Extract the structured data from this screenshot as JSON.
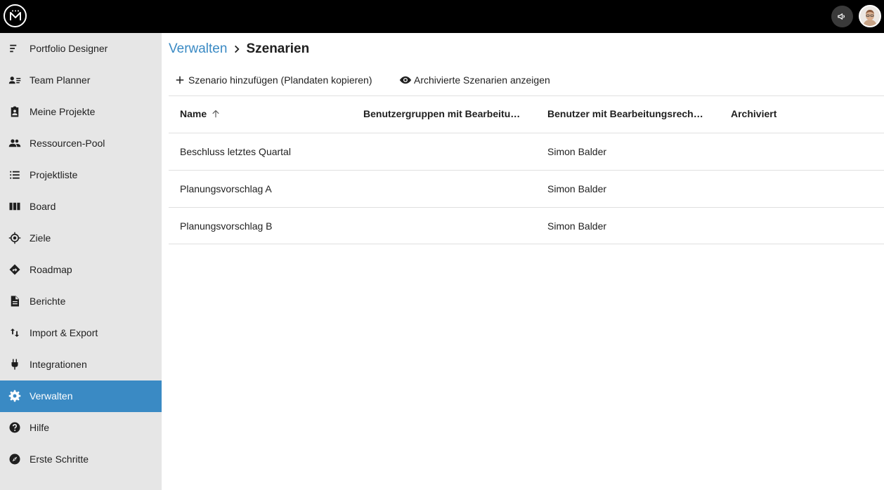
{
  "header": {
    "logo_icon": "brand-logo-icon",
    "announce_icon": "megaphone-icon",
    "avatar_icon": "user-avatar"
  },
  "sidebar": {
    "items": [
      {
        "label": "Portfolio Designer",
        "icon": "portfolio-designer-icon"
      },
      {
        "label": "Team Planner",
        "icon": "team-planner-icon"
      },
      {
        "label": "Meine Projekte",
        "icon": "my-projects-icon"
      },
      {
        "label": "Ressourcen-Pool",
        "icon": "resource-pool-icon"
      },
      {
        "label": "Projektliste",
        "icon": "list-icon"
      },
      {
        "label": "Board",
        "icon": "board-icon"
      },
      {
        "label": "Ziele",
        "icon": "target-icon"
      },
      {
        "label": "Roadmap",
        "icon": "roadmap-icon"
      },
      {
        "label": "Berichte",
        "icon": "document-icon"
      },
      {
        "label": "Import & Export",
        "icon": "import-export-icon"
      },
      {
        "label": "Integrationen",
        "icon": "plug-icon"
      },
      {
        "label": "Verwalten",
        "icon": "gear-icon",
        "active": true
      },
      {
        "label": "Hilfe",
        "icon": "help-icon"
      },
      {
        "label": "Erste Schritte",
        "icon": "compass-icon"
      }
    ]
  },
  "breadcrumb": {
    "parent": "Verwalten",
    "current": "Szenarien"
  },
  "toolbar": {
    "add_label": "Szenario hinzufügen (Plandaten kopieren)",
    "show_archived_label": "Archivierte Szenarien anzeigen"
  },
  "table": {
    "columns": [
      "Name",
      "Benutzergruppen mit Bearbeitu…",
      "Benutzer mit Bearbeitungsrech…",
      "Archiviert"
    ],
    "sort": {
      "column": "Name",
      "direction": "ascending"
    },
    "rows": [
      {
        "name": "Beschluss letztes Quartal",
        "groups": "",
        "users": "Simon Balder",
        "archived": ""
      },
      {
        "name": "Planungsvorschlag A",
        "groups": "",
        "users": "Simon Balder",
        "archived": ""
      },
      {
        "name": "Planungsvorschlag B",
        "groups": "",
        "users": "Simon Balder",
        "archived": ""
      }
    ]
  },
  "colors": {
    "accent": "#3a8ac4",
    "topbar": "#000000",
    "sidebar_bg": "#e6e6e6"
  }
}
